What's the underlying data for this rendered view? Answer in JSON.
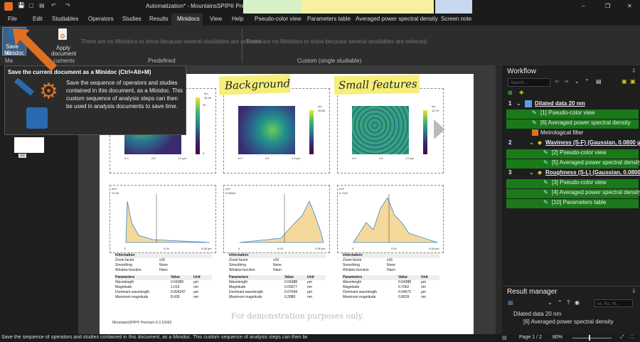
{
  "window": {
    "title": "Automatization* - MountainsSPIP® Premium",
    "minimize": "–",
    "restore": "❐",
    "close": "✕"
  },
  "menu": {
    "file": "File",
    "tabs": [
      "Edit",
      "Studiables",
      "Operators",
      "Studies",
      "Results",
      "Minidocs",
      "View",
      "Help",
      "Pseudo-color view",
      "Parameters table",
      "Averaged power spectral density",
      "Screen note"
    ],
    "active": "Minidocs"
  },
  "ribbon": {
    "save_label_1": "Save as",
    "save_label_2": "Minidoc",
    "apply_label_1": "Apply",
    "apply_label_2": "document",
    "group_left_frag_1": "Ma",
    "group_left_frag_2": "cuments",
    "predefined_msg": "There are no Minidocs to show because several studiables are selected.",
    "custom_msg": "There are no Minidocs to show because several studiables are selected.",
    "predefined_label": "Predefined",
    "custom_label": "Custom (single studiable)"
  },
  "tooltip": {
    "title": "Save the current document as a Minidoc (Ctrl+Alt+M)",
    "body": "Save the sequence of operators and studies contained in this document, as a Minidoc. This custom sequence of analysis steps can then be used in analysis documents to save time."
  },
  "thumb_label": "1/2",
  "notes": {
    "background": "Background",
    "small_features": "Small features"
  },
  "maps": [
    {
      "unit": "nm",
      "max": "34.46",
      "ticks": [
        "30",
        "25",
        "20",
        "15",
        "10",
        "5",
        "0"
      ],
      "x": [
        "0.0",
        "0.5",
        "1.0 µm"
      ]
    },
    {
      "unit": "nm",
      "max": "26.86",
      "ticks": [
        "25",
        "20",
        "15",
        "10",
        "5",
        "0"
      ],
      "x": [
        "0.0",
        "0.5",
        "1.0 µm"
      ]
    },
    {
      "unit": "nm",
      "max": "13.76",
      "ticks": [
        "12",
        "10",
        "8",
        "6",
        "4",
        "2",
        "0"
      ],
      "x": [
        "0.0",
        "0.5",
        "1.0 µm"
      ]
    }
  ],
  "spectra": [
    {
      "unit": "nm²",
      "top": "71.06",
      "x": [
        "0",
        "0.02",
        "0.04",
        "0.06",
        "0.08 µm"
      ]
    },
    {
      "unit": "nm²",
      "top": "0.08344",
      "x": [
        "0",
        "0.02",
        "0.04",
        "0.06",
        "0.08 µm"
      ]
    },
    {
      "unit": "nm²",
      "top": "0.7447",
      "x": [
        "0",
        "0.02",
        "0.04",
        "0.06",
        "0.08 µm"
      ]
    }
  ],
  "info_tables": [
    {
      "zoom": "x16",
      "smoothing": "None",
      "window": "Hann",
      "wavelength": "0.04389",
      "magnitude": "1.015",
      "dom_wl": "0.004247",
      "max_mag": "8.430"
    },
    {
      "zoom": "x16",
      "smoothing": "None",
      "window": "Hann",
      "wavelength": "0.04388",
      "magnitude": "0.09077",
      "dom_wl": "0.07644",
      "max_mag": "0.2889"
    },
    {
      "zoom": "x16",
      "smoothing": "None",
      "window": "Hann",
      "wavelength": "0.04388",
      "magnitude": "0.7062",
      "dom_wl": "0.04672",
      "max_mag": "0.8629"
    }
  ],
  "labels": {
    "information": "Information",
    "zoom": "Zoom factor",
    "smoothing": "Smoothing",
    "window": "Window function",
    "parameters": "Parameters",
    "value": "Value",
    "unit": "Unit",
    "wavelength": "Wavelength",
    "magnitude": "Magnitude",
    "dom_wl": "Dominant wavelength",
    "max_mag": "Maximum magnitude",
    "um": "µm",
    "nm": "nm"
  },
  "doc_footer": "MountainsSPIP® Premium 9.3.10663",
  "watermark": "For demonstration purposes only.",
  "workflow": {
    "title": "Workflow",
    "search_placeholder": "Search...",
    "rows": [
      {
        "num": "1",
        "label": "Dilated data 20 nm",
        "bold": true,
        "green": false,
        "indent": 0
      },
      {
        "num": "",
        "label": "[1] Pseudo-color view",
        "bold": false,
        "green": true,
        "indent": 2
      },
      {
        "num": "",
        "label": "[6] Averaged power spectral density",
        "bold": false,
        "green": true,
        "indent": 2
      },
      {
        "num": "",
        "label": "Metrological filter",
        "bold": false,
        "green": false,
        "indent": 2
      },
      {
        "num": "2",
        "label": "Waviness (S-F) (Gaussian, 0.0800 µm)",
        "bold": true,
        "green": false,
        "indent": 3
      },
      {
        "num": "",
        "label": "[2] Pseudo-color view",
        "bold": false,
        "green": true,
        "indent": 4
      },
      {
        "num": "",
        "label": "[5] Averaged power spectral density",
        "bold": false,
        "green": true,
        "indent": 4
      },
      {
        "num": "3",
        "label": "Roughness (S-L) (Gaussian, 0.0800 µm)",
        "bold": true,
        "green": false,
        "indent": 3
      },
      {
        "num": "",
        "label": "[3] Pseudo-color view",
        "bold": false,
        "green": true,
        "indent": 4
      },
      {
        "num": "",
        "label": "[4] Averaged power spectral density",
        "bold": false,
        "green": true,
        "indent": 4
      },
      {
        "num": "",
        "label": "[10] Parameters table",
        "bold": false,
        "green": true,
        "indent": 4
      }
    ]
  },
  "result_manager": {
    "title": "Result manager",
    "search_placeholder": "ex. Ra, W...",
    "items": [
      "Dilated data 20 nm",
      "[6] Averaged power spectral density"
    ]
  },
  "status": {
    "text": "Save the sequence of operators and studies contained in this document, as a Minidoc. This custom sequence of analysis steps can then be u",
    "page": "Page 1 / 2",
    "zoom": "80%"
  },
  "colors": {
    "accent": "#1a7a1a",
    "note": "#f5ef7a",
    "active_tab": "#2d2d2d"
  }
}
